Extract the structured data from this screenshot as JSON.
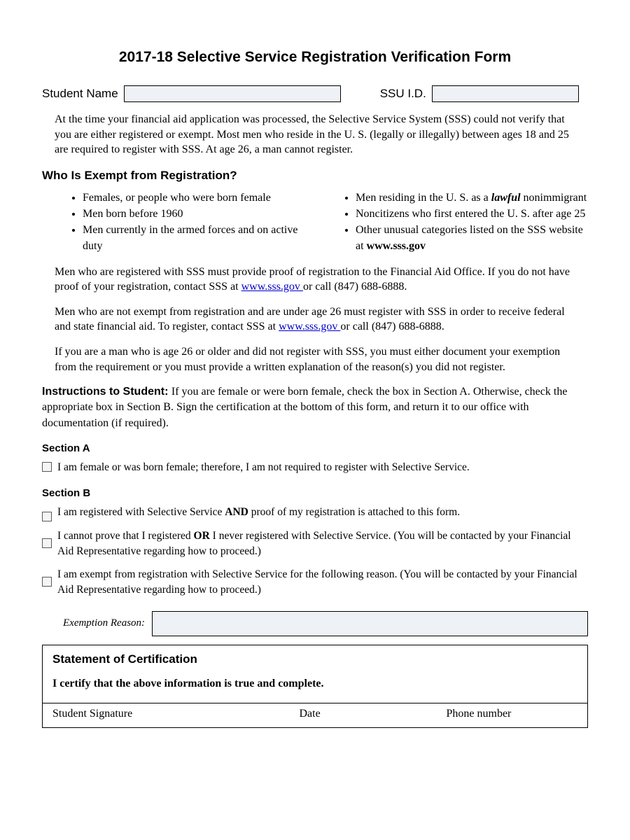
{
  "title": "2017-18 Selective Service Registration Verification Form",
  "fields": {
    "student_name_label": "Student Name",
    "ssu_id_label": "SSU I.D."
  },
  "intro": "At the time your financial aid application was processed, the Selective Service System (SSS) could not verify that you are either registered or exempt. Most men who reside in the U. S. (legally or illegally) between ages 18 and 25 are required to register with SSS. At age 26, a man cannot register.",
  "exempt_heading": "Who Is Exempt from Registration?",
  "exempt_left": [
    "Females, or people who were born female",
    "Men born before 1960",
    "Men currently in the armed forces and on active duty"
  ],
  "exempt_right": {
    "item1_a": "Men residing in the U. S. as a ",
    "item1_b_bi": "lawful",
    "item1_c": " nonimmigrant",
    "item2": "Noncitizens who first entered the U. S. after age 25",
    "item3_a": "Other unusual categories listed on the SSS website at ",
    "item3_link": "www.sss.gov"
  },
  "para1_a": "Men who are registered with SSS must provide proof of registration to the Financial Aid Office. If you do not have proof of your registration, contact SSS at ",
  "para1_link": "www.sss.gov ",
  "para1_b": "or call (847) 688-6888.",
  "para2_a": "Men who are not exempt from registration and are under age 26 must register with SSS in order to receive federal and state financial aid. To register, contact SSS at ",
  "para2_link": "www.sss.gov ",
  "para2_b": "or call (847) 688-6888.",
  "para3": "If you are a man who is age 26 or older and did not register with SSS, you must either document your exemption from the requirement or you must provide a written explanation of the reason(s) you did not register.",
  "instructions_label": "Instructions to Student: ",
  "instructions_text": "If you are female or were born female, check the box in Section A. Otherwise, check the appropriate box in Section B. Sign the certification at the bottom of this form, and return it to our office with documentation (if required).",
  "section_a_label": "Section A",
  "section_a_opt": "I am female or was born female; therefore, I am not required to register with Selective Service.",
  "section_b_label": "Section B",
  "section_b_opt1_a": "I am registered with Selective Service ",
  "section_b_opt1_b": "AND",
  "section_b_opt1_c": " proof of my registration is attached to this form.",
  "section_b_opt2_a": "I cannot prove that I registered ",
  "section_b_opt2_b": "OR",
  "section_b_opt2_c": " I never registered with Selective Service. (You will be contacted by your Financial Aid Representative regarding how to proceed.)",
  "section_b_opt3": "I am exempt from registration with Selective Service for the following reason. (You will be contacted by your Financial Aid Representative regarding how to proceed.)",
  "exemption_label": "Exemption Reason:",
  "cert": {
    "heading": "Statement of Certification",
    "statement": "I certify that the above information is true and complete.",
    "sig_label": "Student Signature",
    "date_label": "Date",
    "phone_label": "Phone number"
  }
}
